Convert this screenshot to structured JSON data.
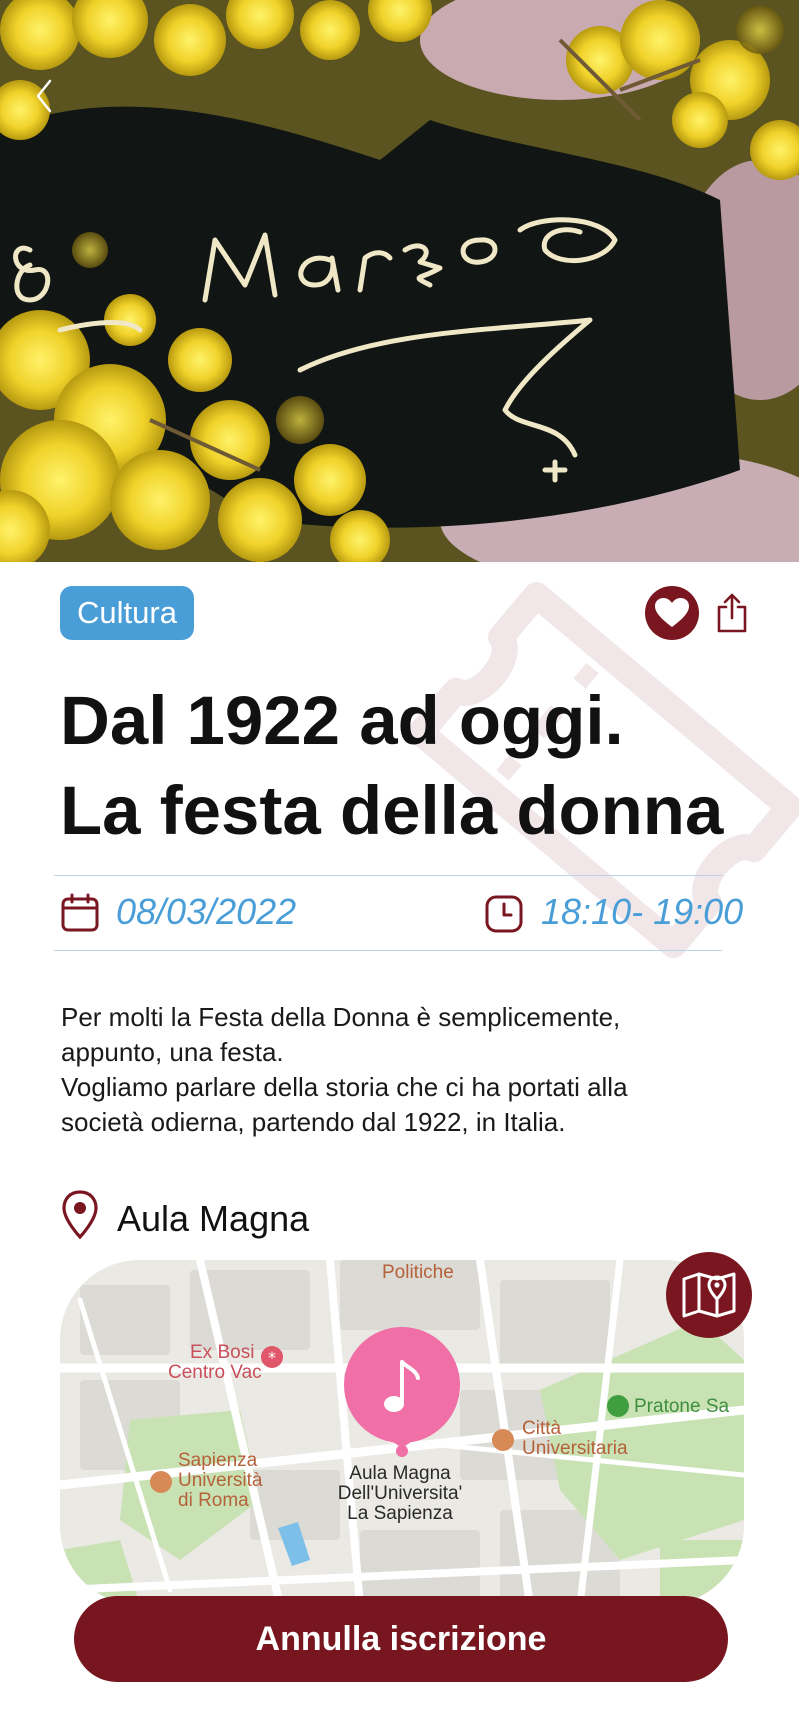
{
  "hero": {
    "image_text": "8 Marzo"
  },
  "event": {
    "category": "Cultura",
    "title_line1": "Dal 1922 ad oggi.",
    "title_line2": "La festa della donna",
    "date": "08/03/2022",
    "time": "18:10- 19:00",
    "description": [
      "Per molti la Festa della Donna è semplicemente,",
      "appunto, una festa.",
      "Vogliamo parlare della storia che ci ha portati alla",
      "società odierna, partendo dal 1922, in Italia."
    ]
  },
  "location": {
    "name": "Aula Magna",
    "map_labels": {
      "politiche": "Politiche",
      "ex_bosi_1": "Ex Bosi",
      "ex_bosi_2": "Centro Vac",
      "pratone": "Pratone Sa",
      "citta_1": "Città",
      "citta_2": "Universitaria",
      "sapienza_1": "Sapienza",
      "sapienza_2": "Università",
      "sapienza_3": "di Roma",
      "aula_1": "Aula Magna",
      "aula_2": "Dell'Universita'",
      "aula_3": "La Sapienza"
    }
  },
  "actions": {
    "cancel_label": "Annulla iscrizione"
  },
  "icons": {
    "back": "chevron-left-icon",
    "favorite": "heart-icon",
    "share": "share-icon",
    "calendar": "calendar-icon",
    "clock": "clock-icon",
    "location": "location-pin-icon",
    "map": "map-icon",
    "music": "music-note-icon"
  },
  "colors": {
    "accent_blue": "#4a9ed8",
    "brand_red": "#7a1620",
    "map_pin_pink": "#ef6fa6"
  }
}
